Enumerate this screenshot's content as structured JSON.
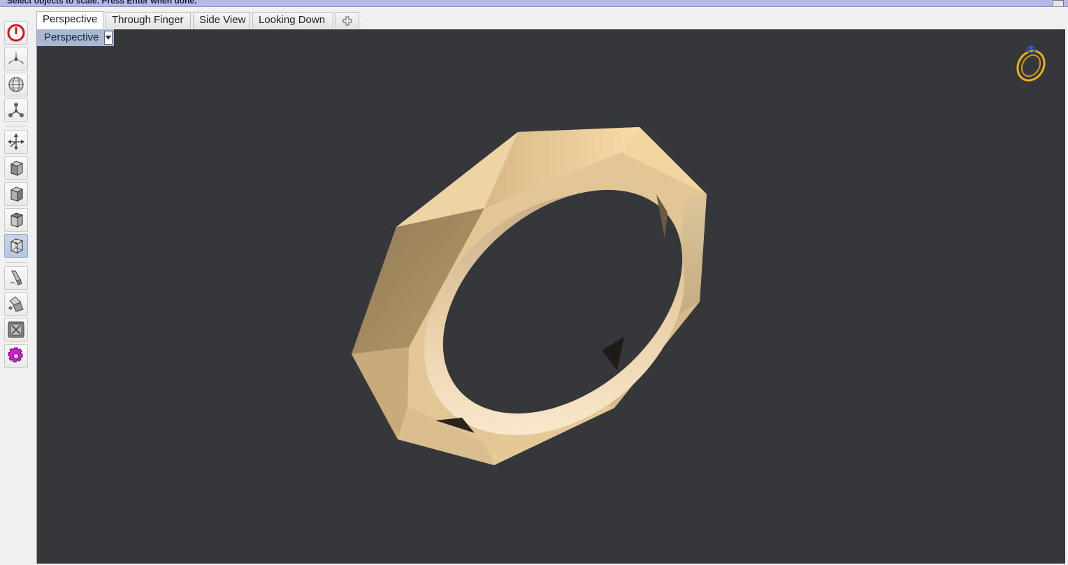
{
  "command_prompt": "Select objects to scale. Press Enter when done.",
  "tabs": [
    {
      "label": "Perspective",
      "active": true
    },
    {
      "label": "Through Finger",
      "active": false
    },
    {
      "label": "Side View",
      "active": false
    },
    {
      "label": "Looking Down",
      "active": false
    }
  ],
  "add_tab_icon": "plus-icon",
  "viewport": {
    "label": "Perspective",
    "dropdown_icon": "chevron-down-icon",
    "background_color": "#35373a"
  },
  "toolbar": {
    "tools": [
      {
        "icon": "power-icon",
        "pressed": false
      },
      {
        "icon": "axis-tripod-icon",
        "pressed": false
      },
      {
        "icon": "globe-icon",
        "pressed": false
      },
      {
        "icon": "node-graph-icon",
        "pressed": false
      },
      {
        "icon": "move-axes-icon",
        "pressed": false
      },
      {
        "icon": "cube-front-icon",
        "pressed": false
      },
      {
        "icon": "cube-side-icon",
        "pressed": false
      },
      {
        "icon": "cube-top-icon",
        "pressed": false
      },
      {
        "icon": "cube-wire-icon",
        "pressed": true
      },
      {
        "icon": "eyedropper-icon",
        "pressed": false
      },
      {
        "icon": "paint-bucket-icon",
        "pressed": false
      },
      {
        "icon": "render-frame-icon",
        "pressed": false
      },
      {
        "icon": "settings-gear-icon",
        "pressed": false
      }
    ]
  },
  "colors": {
    "gold": "#e6c48e",
    "command_bar": "#b7b8e8",
    "viewport_label_bg": "#a9b8cc"
  },
  "model": "gold faceted ring"
}
